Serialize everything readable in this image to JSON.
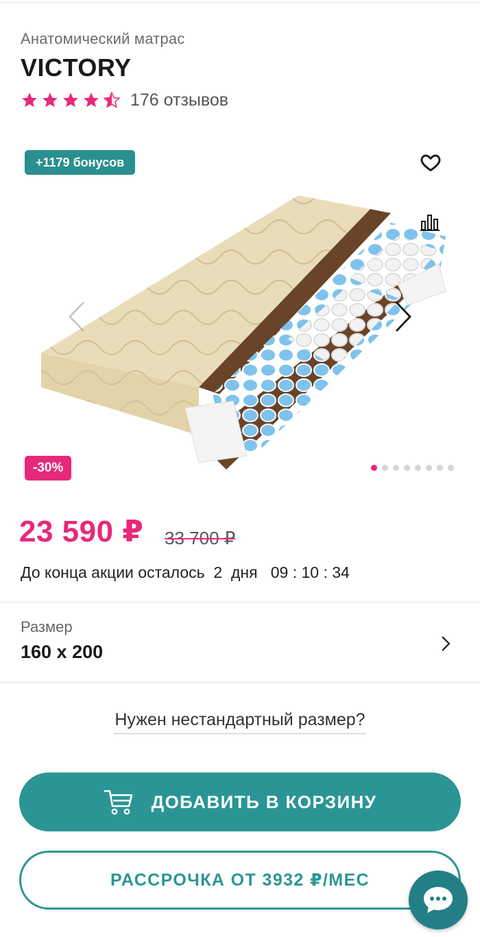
{
  "product": {
    "subtitle": "Анатомический матрас",
    "title": "VICTORY",
    "rating": 4.5,
    "reviews": "176 отзывов"
  },
  "gallery": {
    "bonus_badge": "+1179 бонусов",
    "discount_badge": "-30%",
    "slides_total": 8,
    "active_slide": 1,
    "icons": [
      "heart-icon",
      "compare-icon",
      "chevron-left-icon",
      "chevron-right-icon"
    ]
  },
  "pricing": {
    "price": "23 590 ₽",
    "old_price": "33 700 ₽"
  },
  "timer": {
    "prefix": "До конца акции осталось",
    "days": "2",
    "days_word": "дня",
    "time": "09 : 10 : 34"
  },
  "size": {
    "label": "Размер",
    "value": "160 x 200"
  },
  "custom_size": "Нужен нестандартный размер?",
  "buttons": {
    "add_to_cart": "ДОБАВИТЬ В КОРЗИНУ",
    "installment": "РАССРОЧКА ОТ 3932 ₽/МЕС"
  },
  "colors": {
    "accent_pink": "#e8287a",
    "accent_teal": "#2b9595",
    "chat_teal": "#237f86"
  }
}
